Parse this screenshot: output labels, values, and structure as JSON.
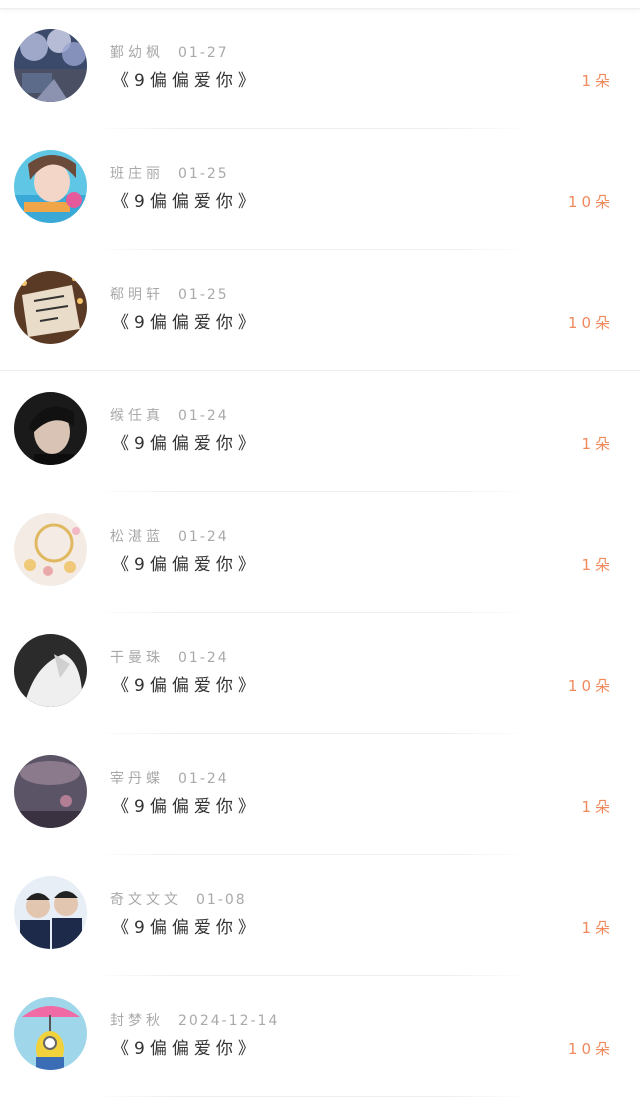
{
  "records": [
    {
      "name": "鄞幼枫",
      "date": "01-27",
      "gift": "《9偏偏爱你》",
      "count": "1朵",
      "avatar": "avatar-cherry-blossom-street"
    },
    {
      "name": "班庄丽",
      "date": "01-25",
      "gift": "《9偏偏爱你》",
      "count": "10朵",
      "avatar": "avatar-girl-with-heart"
    },
    {
      "name": "郗明轩",
      "date": "01-25",
      "gift": "《9偏偏爱你》",
      "count": "10朵",
      "avatar": "avatar-christmas-note"
    },
    {
      "name": "缑任真",
      "date": "01-24",
      "gift": "《9偏偏爱你》",
      "count": "1朵",
      "avatar": "avatar-young-man-dark"
    },
    {
      "name": "松湛蓝",
      "date": "01-24",
      "gift": "《9偏偏爱你》",
      "count": "1朵",
      "avatar": "avatar-gold-jewelry"
    },
    {
      "name": "干曼珠",
      "date": "01-24",
      "gift": "《9偏偏爱你》",
      "count": "10朵",
      "avatar": "avatar-white-shirt-bw"
    },
    {
      "name": "宰丹蝶",
      "date": "01-24",
      "gift": "《9偏偏爱你》",
      "count": "1朵",
      "avatar": "avatar-dusk-clouds"
    },
    {
      "name": "奇文文文",
      "date": "01-08",
      "gift": "《9偏偏爱你》",
      "count": "1朵",
      "avatar": "avatar-two-boys"
    },
    {
      "name": "封梦秋",
      "date": "2024-12-14",
      "gift": "《9偏偏爱你》",
      "count": "10朵",
      "avatar": "avatar-minion-umbrella"
    }
  ],
  "colors": {
    "count": "#f08a5d",
    "name": "#a9a9a9",
    "gift": "#333333",
    "divider": "#eeeeee"
  }
}
